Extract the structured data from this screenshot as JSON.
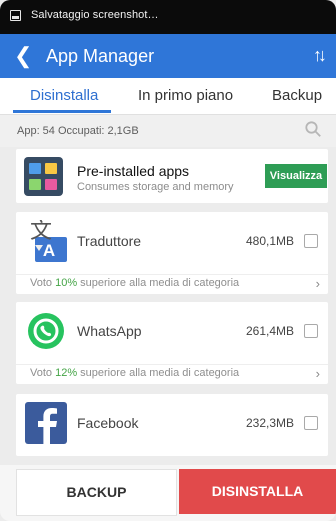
{
  "colors": {
    "statusbar": "#0b0b0b",
    "appbar": "#2f76d8",
    "view_button": "#2e9d55",
    "uninstall_button": "#e14a4b",
    "vote_percent": "#44a446"
  },
  "status_bar": {
    "text": "Salvataggio screenshot…",
    "icon": "screenshot-icon"
  },
  "header": {
    "back_icon": "back-icon",
    "title": "App Manager",
    "sort_icon": "sort-icon"
  },
  "tabs": [
    {
      "label": "Disinstalla",
      "active": true
    },
    {
      "label": "In primo piano",
      "active": false
    },
    {
      "label": "Backup",
      "active": false
    }
  ],
  "summary": {
    "text": "App: 54   Occupati: 2,1GB",
    "search_icon": "search-icon"
  },
  "preinstalled": {
    "title": "Pre-installed apps",
    "subtitle": "Consumes storage and memory",
    "button": "Visualizza",
    "icon": "apps-grid-icon"
  },
  "apps": [
    {
      "name": "Traduttore",
      "size": "480,1MB",
      "vote_prefix": "Voto ",
      "vote_percent": "10%",
      "vote_suffix": " superiore alla media di categoria",
      "icon": "translate-icon"
    },
    {
      "name": "WhatsApp",
      "size": "261,4MB",
      "vote_prefix": "Voto ",
      "vote_percent": "12%",
      "vote_suffix": " superiore alla media di categoria",
      "icon": "whatsapp-icon"
    },
    {
      "name": "Facebook",
      "size": "232,3MB",
      "icon": "facebook-icon"
    }
  ],
  "bottom": {
    "backup": "BACKUP",
    "uninstall": "DISINSTALLA"
  }
}
